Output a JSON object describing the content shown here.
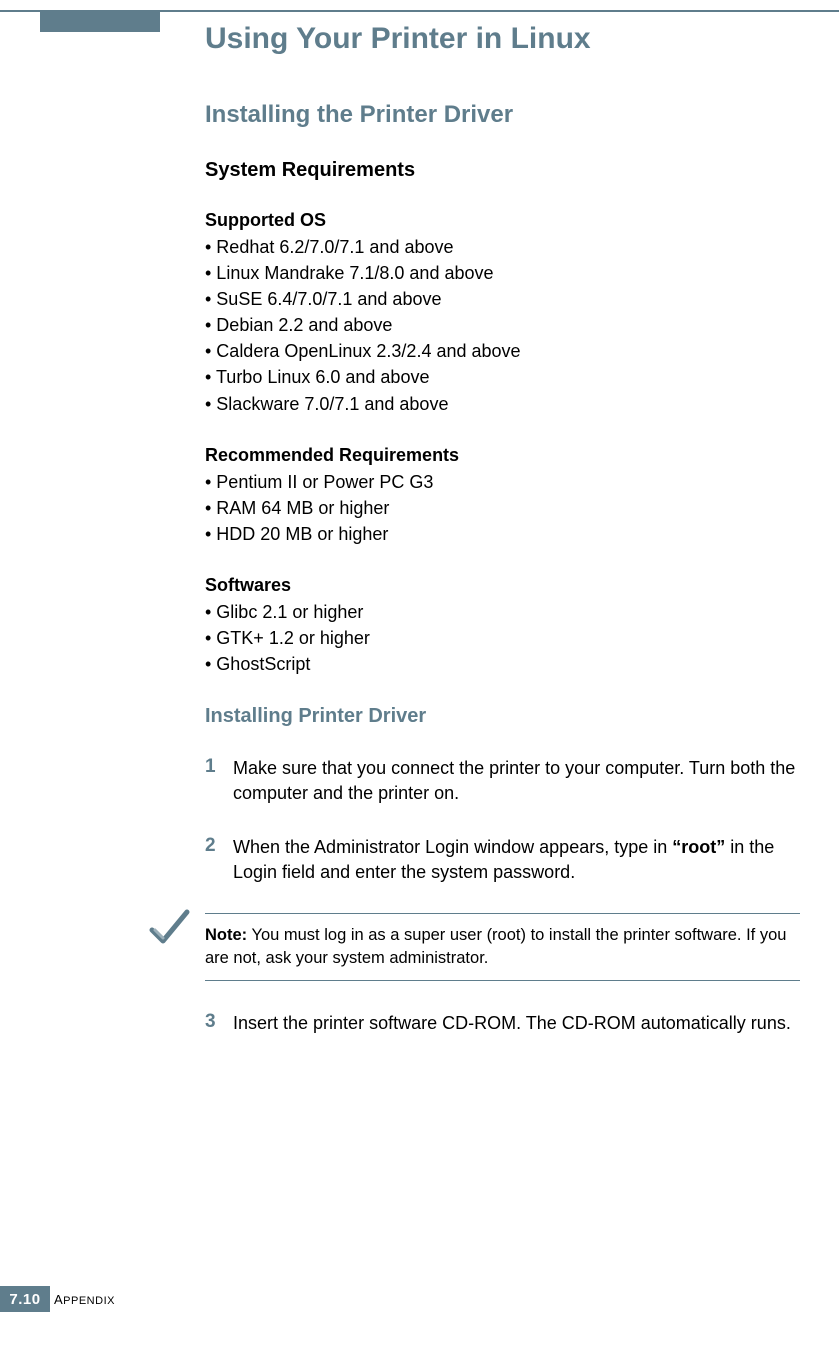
{
  "page": {
    "title": "Using Your Printer in Linux",
    "section1_title": "Installing the Printer Driver",
    "subsection_sysreq": "System Requirements",
    "supported_os_heading": "Supported OS",
    "supported_os": [
      "• Redhat 6.2/7.0/7.1 and above",
      "• Linux Mandrake 7.1/8.0 and above",
      "• SuSE 6.4/7.0/7.1 and above",
      "• Debian 2.2 and above",
      "• Caldera OpenLinux 2.3/2.4 and above",
      "• Turbo Linux 6.0 and above",
      "• Slackware 7.0/7.1 and above"
    ],
    "recommended_heading": "Recommended Requirements",
    "recommended": [
      "• Pentium II or Power PC G3",
      "• RAM 64 MB or higher",
      "• HDD 20 MB or higher"
    ],
    "softwares_heading": "Softwares",
    "softwares": [
      "• Glibc 2.1 or higher",
      "• GTK+ 1.2 or higher",
      "• GhostScript"
    ],
    "installing_heading": "Installing Printer Driver",
    "steps": [
      {
        "num": "1",
        "text": "Make sure that you connect the printer to your computer. Turn both the computer and the printer on."
      },
      {
        "num": "2",
        "text_before": "When the Administrator Login window appears, type in ",
        "bold": "“root”",
        "text_after": " in the Login field and enter the system password."
      },
      {
        "num": "3",
        "text": "Insert the printer software CD-ROM. The CD-ROM automatically runs."
      }
    ],
    "note_label": "Note:",
    "note_text": " You must log in as a super user (root) to install the printer software. If you are not, ask your system administrator.",
    "footer": {
      "chapter": "7",
      "page": "10",
      "label": "APPENDIX"
    }
  }
}
